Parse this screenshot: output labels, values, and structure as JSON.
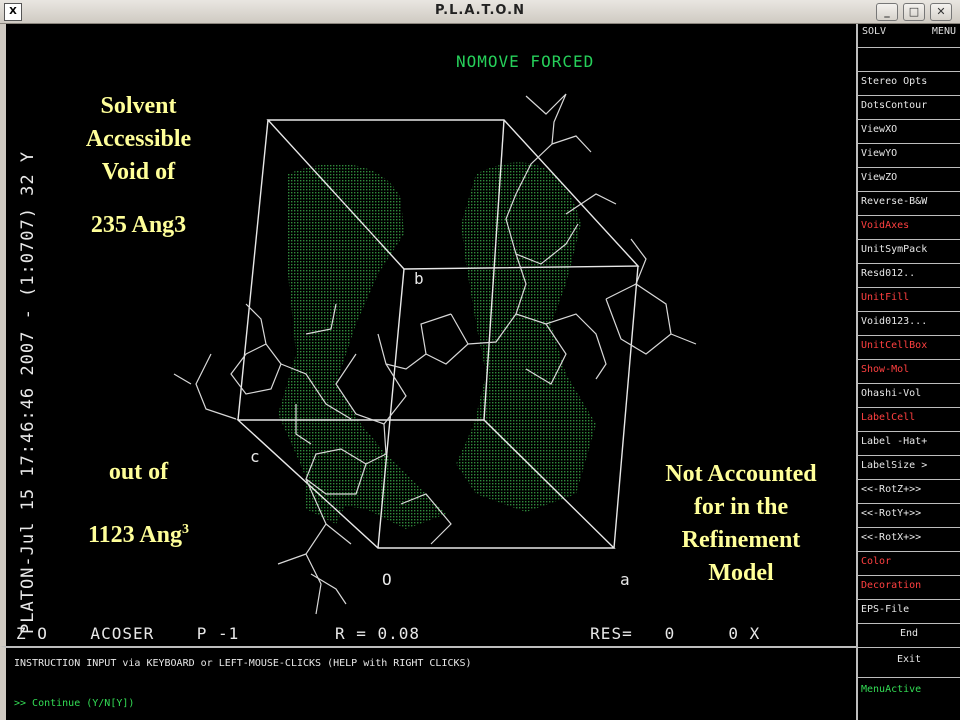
{
  "window": {
    "title": "P.L.A.T.O.N",
    "app_icon": "X"
  },
  "graphics": {
    "mode_text": "NOMOVE FORCED",
    "side_label": "PLATON-Jul 15 17:46:46 2007 - (1:0707)   32 Y",
    "status": "Z O    ACOSER    P -1         R = 0.08                RES=   0     0 X",
    "axis_labels": {
      "b": "b",
      "c": "c",
      "o": "O",
      "a": "a"
    }
  },
  "overlays": {
    "void_title": [
      "Solvent",
      "Accessible",
      "Void of"
    ],
    "void_value": "235 Ang3",
    "out_of": "out of",
    "cell_value": "1123 Ang",
    "cell_sup": "3",
    "note": [
      "Not Accounted",
      "for in the",
      "Refinement",
      "Model"
    ]
  },
  "menu": {
    "head_left": "SOLV",
    "head_right": "MENU",
    "items": [
      "Stereo Opts",
      "DotsContour",
      "ViewXO",
      "ViewYO",
      "ViewZO",
      "Reverse-B&W",
      "VoidAxes",
      "UnitSymPack",
      "Resd012..",
      "UnitFill",
      "Void0123...",
      "UnitCellBox",
      "Show-Mol",
      "Ohashi-Vol",
      "LabelCell",
      "Label -Hat+",
      "LabelSize >",
      "<<-RotZ+>>",
      "<<-RotY+>>",
      "<<-RotX+>>",
      "Color",
      "Decoration",
      "EPS-File",
      "End",
      "Exit",
      "MenuActive"
    ]
  },
  "instruction": {
    "line1": "INSTRUCTION INPUT via KEYBOARD or LEFT-MOUSE-CLICKS (HELP with RIGHT CLICKS)",
    "line2": ">> Continue (Y/N[Y])"
  },
  "colors": {
    "background": "#000000",
    "void_dots": "#2a7a34",
    "accent_green": "#33dd55",
    "menu_red": "#ff4040",
    "overlay_text": "#ffff99"
  }
}
